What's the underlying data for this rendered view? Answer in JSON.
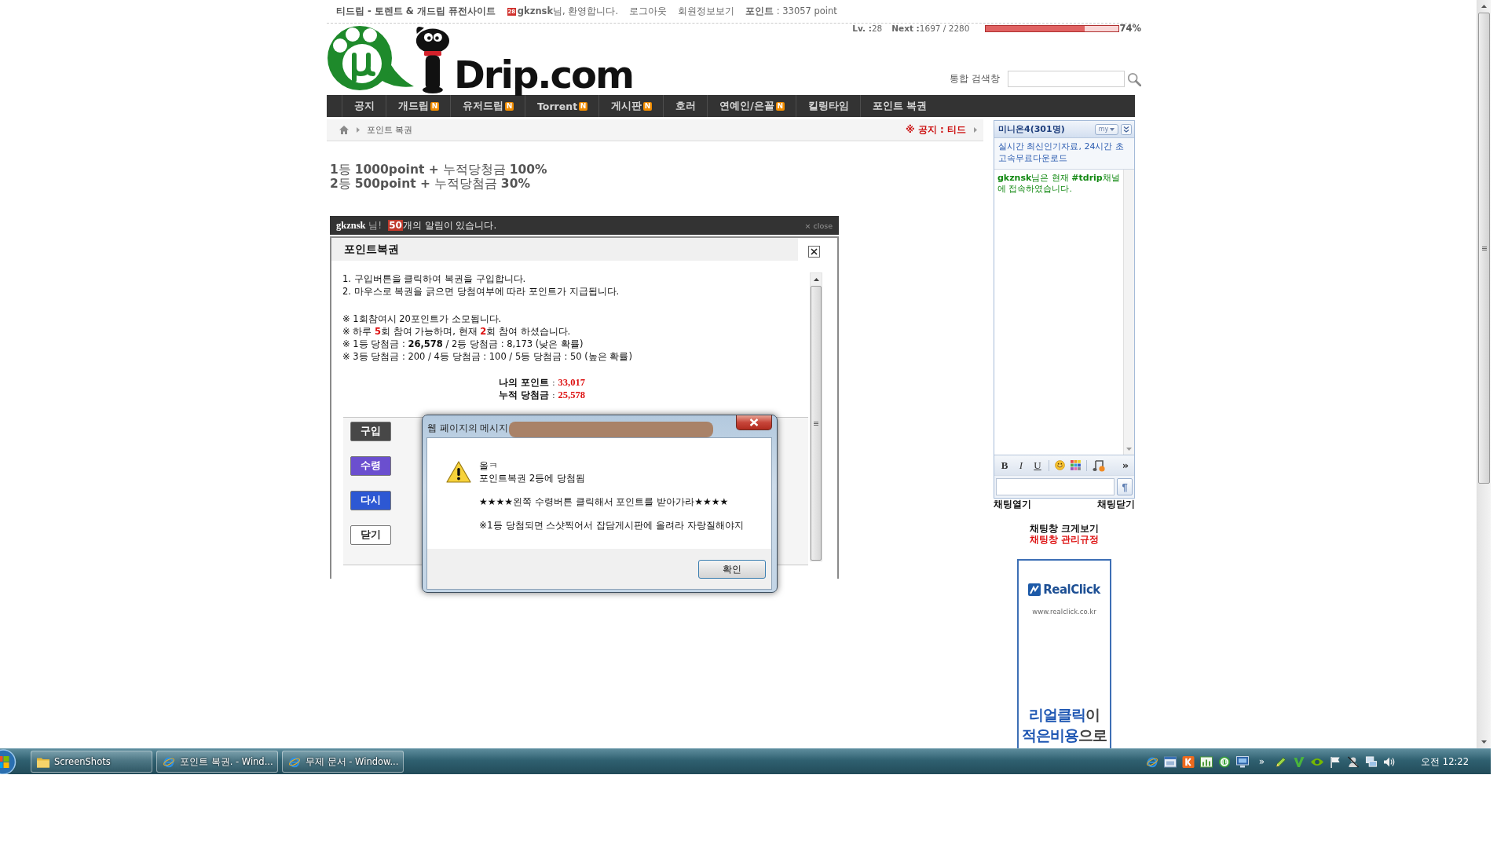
{
  "top_bar": {
    "site_title": "티드립 - 토렌트 & 개드립 퓨전사이트",
    "level_badge": "28",
    "welcome": "**gkznsk**님, 환영합니다.",
    "links": [
      "로그아웃",
      "회원정보보기"
    ],
    "points": "**포인트** : 33057 point"
  },
  "level_info": {
    "lv": "**Lv. :**28",
    "next": "**Next :**1697 / 2280",
    "level": 0.74,
    "percent": "74%"
  },
  "logo": {
    "text": "Drip.com"
  },
  "search": {
    "label": "통합 검색창"
  },
  "nav": [
    {
      "label": "공지"
    },
    {
      "label": "개드립",
      "badge": "N"
    },
    {
      "label": "유저드립",
      "badge": "N"
    },
    {
      "label": "Torrent",
      "badge": "N"
    },
    {
      "label": "게시판",
      "badge": "N"
    },
    {
      "label": "호러"
    },
    {
      "label": "연예인/은꼴",
      "badge": "N"
    },
    {
      "label": "킬링타임"
    },
    {
      "label": "포인트 복권"
    }
  ],
  "breadcrumb": {
    "current": "포인트 복권",
    "notice": "※ 공지 : 티드"
  },
  "prizes": [
    "**1**등  **1000point +** 누적당청금 **100%**",
    "**2**등  **500point +** 누적당첨금 **30%**"
  ],
  "notification": {
    "user": "gkznsk",
    "suffix": "님!",
    "count": "50",
    "message": "개의 알림이 있습니다.",
    "close": "× close"
  },
  "lottery": {
    "title": "포인트복권",
    "instructions": [
      "1. 구입버튼을 클릭하여 복권을 구입합니다.",
      "2. 마우스로 복권을 긁으면 당첨여부에 따라 포인트가 지급됩니다."
    ],
    "rules": [
      {
        "parts": [
          {
            "kind": "plain",
            "text": "※ 1회참여시 20포인트가 소모됩니다."
          }
        ]
      },
      {
        "parts": [
          {
            "kind": "plain",
            "text": "※ 하루 "
          },
          {
            "kind": "red",
            "text": "5"
          },
          {
            "kind": "plain",
            "text": "회 참여 가능하며, 현재 "
          },
          {
            "kind": "red",
            "text": "2"
          },
          {
            "kind": "plain",
            "text": "회 참여 하셨습니다."
          }
        ]
      },
      {
        "parts": [
          {
            "kind": "plain",
            "text": "※ 1등 당첨금 : "
          },
          {
            "kind": "bold",
            "text": "26,578"
          },
          {
            "kind": "plain",
            "text": " / 2등 당첨금 : 8,173 (낮은 확률)"
          }
        ]
      },
      {
        "parts": [
          {
            "kind": "plain",
            "text": "※ 3등 당첨금 : 200 / 4등 당첨금 : 100 / 5등 당첨금 : 50 (높은 확률)"
          }
        ]
      }
    ],
    "summary": [
      {
        "label": "나의 포인트",
        "separator": ":",
        "value": "33,017"
      },
      {
        "label": "누적 당첨금",
        "separator": ":",
        "value": "25,578"
      }
    ],
    "buttons": [
      {
        "label": "구입",
        "color": "#474747"
      },
      {
        "label": "수령",
        "color": "#6b4fcf"
      },
      {
        "label": "다시",
        "color": "#2d58d3"
      },
      {
        "label": "닫기",
        "color": "#ffffff"
      }
    ]
  },
  "dialog": {
    "title": "웹 페이지의 메시지",
    "paragraphs": [
      [
        "올ㅋ",
        "포인트복권 2등에 당첨됨"
      ],
      [
        "★★★★왼쪽 수령버튼 클릭해서 포인트를 받아가라★★★★"
      ],
      [
        "※1등 당첨되면 스샷찍어서 잡담게시판에 올려라 자랑질해야지"
      ]
    ],
    "ok_button": "확인"
  },
  "chat": {
    "title": "미니온4(301명)",
    "my_button": "my",
    "topic": "실시간 최신인기자료, 24시간 초고속무료다운로드",
    "messages": [
      "**gkznsk**님은 현재 **#tdrip**채널에 접속하였습니다."
    ],
    "toolbar": [
      {
        "kind": "bold",
        "label": "B"
      },
      {
        "kind": "italic",
        "label": "I"
      },
      {
        "kind": "underline",
        "label": "U"
      },
      {
        "kind": "separator"
      },
      {
        "kind": "emoji"
      },
      {
        "kind": "palette"
      },
      {
        "kind": "separator"
      },
      {
        "kind": "music"
      },
      {
        "kind": "more",
        "label": "»"
      }
    ],
    "send_button": "¶",
    "open": "채팅열기",
    "close": "채팅닫기",
    "links": [
      {
        "kind": "normal",
        "label": "채팅창 크게보기"
      },
      {
        "kind": "alert",
        "label": "채팅창 관리규정"
      }
    ]
  },
  "ad": {
    "brand": "RealClick",
    "url": "www.realclick.co.kr",
    "headline": [
      "**리얼클릭**이",
      "**적은비용**으로"
    ]
  },
  "taskbar": {
    "windows": [
      {
        "kind": "folder",
        "label": "ScreenShots",
        "selected": false
      },
      {
        "kind": "browser",
        "label": "포인트 복권. - Wind...",
        "selected": false
      },
      {
        "kind": "browser",
        "label": "무제 문서 - Window...",
        "selected": false
      }
    ],
    "tray_more": "»",
    "clock": "오전 12:22"
  }
}
